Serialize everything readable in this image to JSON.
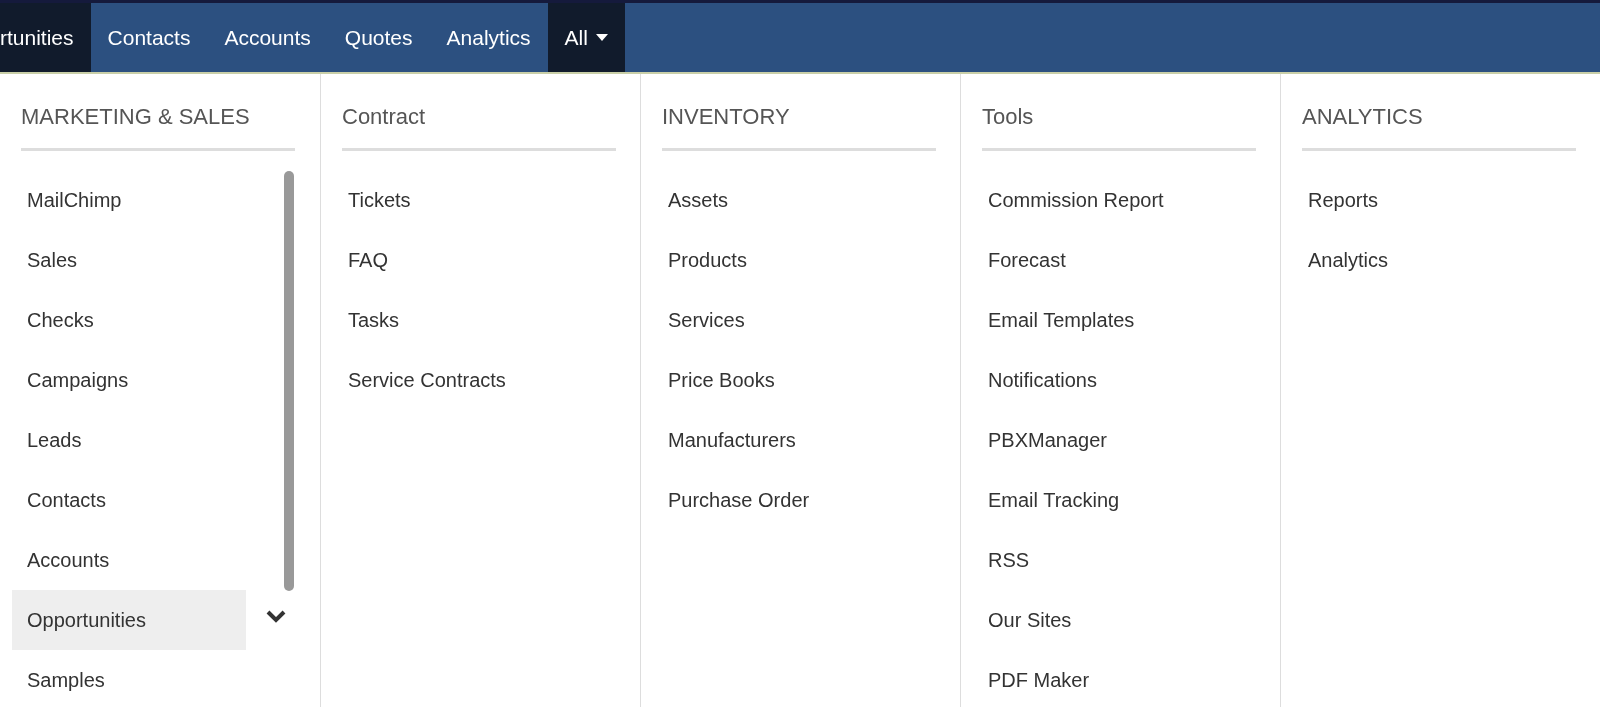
{
  "nav": {
    "items": [
      {
        "label": "rtunities",
        "selected": true
      },
      {
        "label": "Contacts",
        "selected": false
      },
      {
        "label": "Accounts",
        "selected": false
      },
      {
        "label": "Quotes",
        "selected": false
      },
      {
        "label": "Analytics",
        "selected": false
      },
      {
        "label": "All",
        "selected": true,
        "kind": "dropdown"
      }
    ]
  },
  "menu": {
    "columns": [
      {
        "title": "MARKETING & SALES",
        "scrollable": true,
        "items": [
          {
            "label": "MailChimp",
            "selected": false
          },
          {
            "label": "Sales",
            "selected": false
          },
          {
            "label": "Checks",
            "selected": false
          },
          {
            "label": "Campaigns",
            "selected": false
          },
          {
            "label": "Leads",
            "selected": false
          },
          {
            "label": "Contacts",
            "selected": false
          },
          {
            "label": "Accounts",
            "selected": false
          },
          {
            "label": "Opportunities",
            "selected": true
          },
          {
            "label": "Samples",
            "selected": false
          }
        ]
      },
      {
        "title": "Contract",
        "scrollable": false,
        "items": [
          {
            "label": "Tickets",
            "selected": false
          },
          {
            "label": "FAQ",
            "selected": false
          },
          {
            "label": "Tasks",
            "selected": false
          },
          {
            "label": "Service Contracts",
            "selected": false
          }
        ]
      },
      {
        "title": "INVENTORY",
        "scrollable": false,
        "items": [
          {
            "label": "Assets",
            "selected": false
          },
          {
            "label": "Products",
            "selected": false
          },
          {
            "label": "Services",
            "selected": false
          },
          {
            "label": "Price Books",
            "selected": false
          },
          {
            "label": "Manufacturers",
            "selected": false
          },
          {
            "label": "Purchase Order",
            "selected": false
          }
        ]
      },
      {
        "title": "Tools",
        "scrollable": false,
        "items": [
          {
            "label": "Commission Report",
            "selected": false
          },
          {
            "label": "Forecast",
            "selected": false
          },
          {
            "label": "Email Templates",
            "selected": false
          },
          {
            "label": "Notifications",
            "selected": false
          },
          {
            "label": "PBXManager",
            "selected": false
          },
          {
            "label": "Email Tracking",
            "selected": false
          },
          {
            "label": "RSS",
            "selected": false
          },
          {
            "label": "Our Sites",
            "selected": false
          },
          {
            "label": "PDF Maker",
            "selected": false
          }
        ]
      },
      {
        "title": "ANALYTICS",
        "scrollable": false,
        "items": [
          {
            "label": "Reports",
            "selected": false
          },
          {
            "label": "Analytics",
            "selected": false
          }
        ]
      }
    ]
  }
}
